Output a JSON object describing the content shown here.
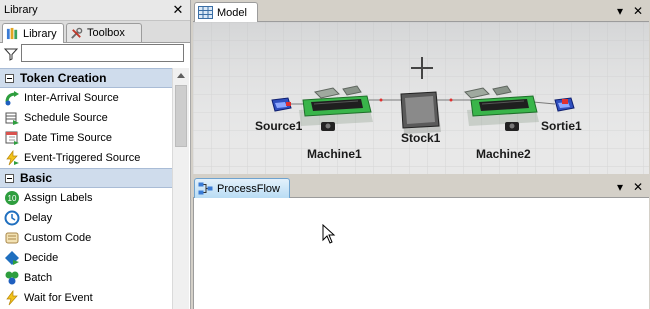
{
  "library": {
    "title": "Library",
    "close": "✕",
    "tabs": [
      {
        "label": "Library",
        "icon": "library-books-icon"
      },
      {
        "label": "Toolbox",
        "icon": "toolbox-icon"
      }
    ],
    "filter": {
      "value": "",
      "icon": "filter-funnel-icon"
    },
    "categories": [
      {
        "label": "Token Creation",
        "items": [
          {
            "label": "Inter-Arrival Source",
            "icon": "inter-arrival-source-icon"
          },
          {
            "label": "Schedule Source",
            "icon": "schedule-source-icon"
          },
          {
            "label": "Date Time Source",
            "icon": "date-time-source-icon"
          },
          {
            "label": "Event-Triggered Source",
            "icon": "event-triggered-source-icon"
          }
        ]
      },
      {
        "label": "Basic",
        "items": [
          {
            "label": "Assign Labels",
            "icon": "assign-labels-icon"
          },
          {
            "label": "Delay",
            "icon": "delay-clock-icon"
          },
          {
            "label": "Custom Code",
            "icon": "custom-code-scroll-icon"
          },
          {
            "label": "Decide",
            "icon": "decide-diamond-icon"
          },
          {
            "label": "Batch",
            "icon": "batch-icon"
          },
          {
            "label": "Wait for Event",
            "icon": "wait-for-event-icon"
          }
        ]
      }
    ]
  },
  "model": {
    "tab_label": "Model",
    "tab_icon": "model-grid-icon",
    "dropdown": "▾",
    "close": "✕",
    "objects": {
      "source": "Source1",
      "machine1": "Machine1",
      "stock": "Stock1",
      "machine2": "Machine2",
      "sink": "Sortie1"
    }
  },
  "processflow": {
    "tab_label": "ProcessFlow",
    "tab_icon": "processflow-icon",
    "dropdown": "▾",
    "close": "✕"
  },
  "colors": {
    "category_header": "#cfdcec",
    "model_floor": "#e6e6e6",
    "machine_green": "#39b54a",
    "tab_active_blue": "#b9dcf4"
  }
}
